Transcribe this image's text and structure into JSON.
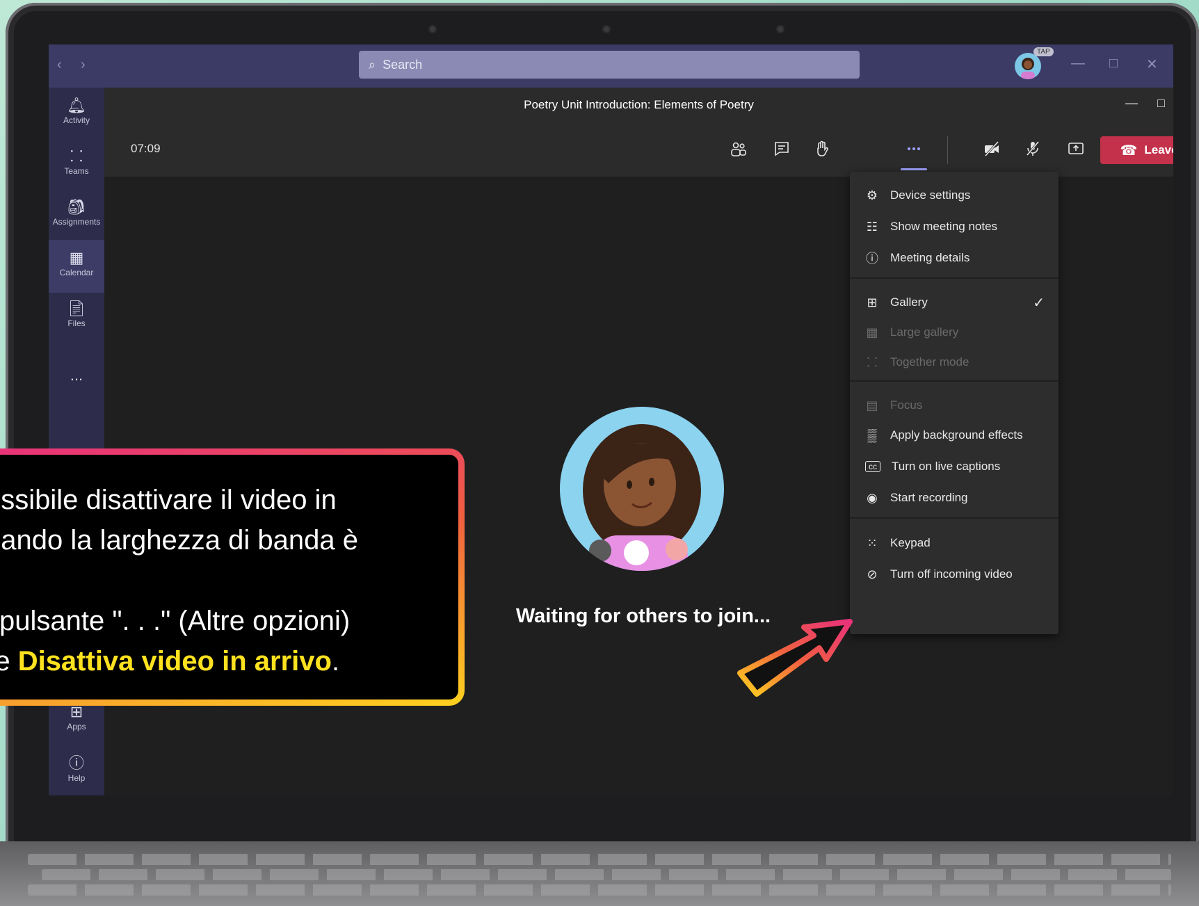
{
  "titlebar": {
    "search_placeholder": "Search",
    "badge": "TAP"
  },
  "rail": {
    "items": [
      {
        "label": "Activity",
        "icon": "bell-icon"
      },
      {
        "label": "Teams",
        "icon": "teams-icon"
      },
      {
        "label": "Assignments",
        "icon": "backpack-icon"
      },
      {
        "label": "Calendar",
        "icon": "calendar-icon"
      },
      {
        "label": "Files",
        "icon": "file-icon"
      },
      {
        "label": "...",
        "icon": "more-icon"
      },
      {
        "label": "Apps",
        "icon": "apps-icon"
      },
      {
        "label": "Help",
        "icon": "help-icon"
      }
    ]
  },
  "meeting": {
    "title": "Poetry Unit Introduction: Elements of Poetry",
    "timer": "07:09",
    "leave_label": "Leave",
    "waiting_text": "Waiting for others to join..."
  },
  "menu": {
    "items": [
      {
        "label": "Device settings",
        "icon": "gear-icon",
        "enabled": true
      },
      {
        "label": "Show meeting notes",
        "icon": "notes-icon",
        "enabled": true
      },
      {
        "label": "Meeting details",
        "icon": "info-icon",
        "enabled": true
      },
      {
        "label": "Gallery",
        "icon": "gallery-icon",
        "enabled": true,
        "checked": true
      },
      {
        "label": "Large gallery",
        "icon": "large-gallery-icon",
        "enabled": false
      },
      {
        "label": "Together mode",
        "icon": "together-mode-icon",
        "enabled": false
      },
      {
        "label": "Focus",
        "icon": "focus-icon",
        "enabled": false
      },
      {
        "label": "Apply background effects",
        "icon": "background-effects-icon",
        "enabled": true
      },
      {
        "label": "Turn on live captions",
        "icon": "captions-icon",
        "enabled": true
      },
      {
        "label": "Start recording",
        "icon": "record-icon",
        "enabled": true
      },
      {
        "label": "Keypad",
        "icon": "keypad-icon",
        "enabled": true
      },
      {
        "label": "Turn off incoming video",
        "icon": "video-off-icon",
        "enabled": true
      }
    ]
  },
  "callout": {
    "line1": "ossibile disattivare il  video in",
    "line2": "uando la larghezza  di banda è",
    "line3": "l pulsante \". . .\" (Altre opzioni)",
    "line4_prefix": "re  ",
    "line4_highlight": "Disattiva video in arrivo",
    "line4_suffix": "."
  },
  "colors": {
    "titlebar": "#3b3b66",
    "rail": "#2d2c4a",
    "leave": "#c4314b",
    "highlight": "#ffe21f"
  }
}
